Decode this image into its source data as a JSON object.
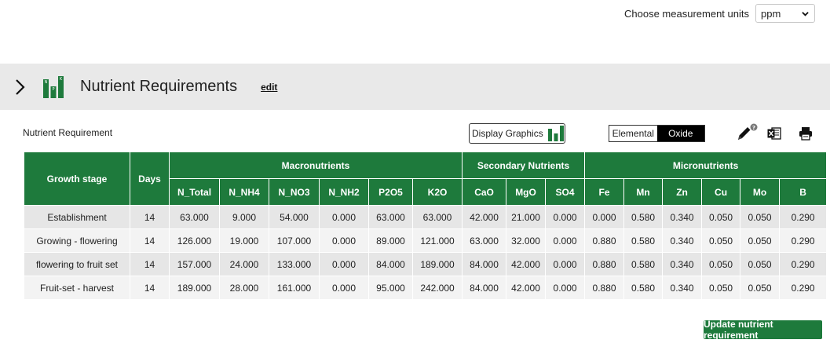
{
  "units": {
    "label": "Choose measurement units",
    "selected": "ppm"
  },
  "section": {
    "title": "Nutrient Requirements",
    "edit_label": "edit"
  },
  "toolbar": {
    "nr_label": "Nutrient Requirement",
    "display_graphics_label": "Display Graphics",
    "toggle_options": [
      "Elemental",
      "Oxide"
    ],
    "toggle_active": "Oxide"
  },
  "table": {
    "group_headers": {
      "growth_stage": "Growth stage",
      "days": "Days",
      "macro": "Macronutrients",
      "secondary": "Secondary Nutrients",
      "micro": "Micronutrients"
    },
    "columns": [
      "N_Total",
      "N_NH4",
      "N_NO3",
      "N_NH2",
      "P2O5",
      "K2O",
      "CaO",
      "MgO",
      "SO4",
      "Fe",
      "Mn",
      "Zn",
      "Cu",
      "Mo",
      "B"
    ],
    "rows": [
      [
        "Establishment",
        "14",
        "63.000",
        "9.000",
        "54.000",
        "0.000",
        "63.000",
        "63.000",
        "42.000",
        "21.000",
        "0.000",
        "0.000",
        "0.580",
        "0.340",
        "0.050",
        "0.050",
        "0.290"
      ],
      [
        "Growing - flowering",
        "14",
        "126.000",
        "19.000",
        "107.000",
        "0.000",
        "89.000",
        "121.000",
        "63.000",
        "32.000",
        "0.000",
        "0.880",
        "0.580",
        "0.340",
        "0.050",
        "0.050",
        "0.290"
      ],
      [
        "flowering to fruit set",
        "14",
        "157.000",
        "24.000",
        "133.000",
        "0.000",
        "84.000",
        "189.000",
        "84.000",
        "42.000",
        "0.000",
        "0.880",
        "0.580",
        "0.340",
        "0.050",
        "0.050",
        "0.290"
      ],
      [
        "Fruit-set - harvest",
        "14",
        "189.000",
        "28.000",
        "161.000",
        "0.000",
        "95.000",
        "242.000",
        "84.000",
        "42.000",
        "0.000",
        "0.880",
        "0.580",
        "0.340",
        "0.050",
        "0.050",
        "0.290"
      ]
    ]
  },
  "update_button_label": "Update nutrient requirement",
  "colors": {
    "brand_green": "#1e7a3c",
    "header_band": "#e9e9e9",
    "row_odd": "#e6e6e6",
    "row_even": "#f3f3f3"
  },
  "icons": {
    "expand": "chevron-right-icon",
    "logo": "bar-chart-logo-icon",
    "edit_tool": "pencil-help-icon",
    "excel": "excel-icon",
    "print": "printer-icon"
  }
}
